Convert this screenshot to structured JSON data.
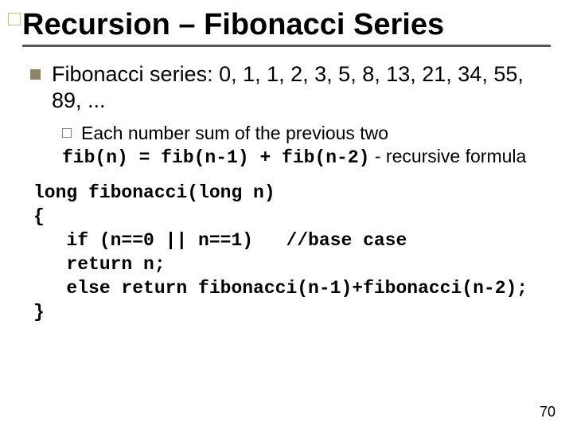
{
  "title": "Recursion – Fibonacci Series",
  "bullet1": "Fibonacci series: 0, 1, 1, 2, 3, 5, 8, 13, 21, 34, 55, 89, ...",
  "sub1_line1": "Each number sum of the previous two",
  "sub1_line2_pre": "fib(n) = fib(n-1) + fib(n-2)",
  "sub1_line2_post": " - recursive formula",
  "code": "long fibonacci(long n)\n{\n   if (n==0 || n==1)   //base case\n   return n;\n   else return fibonacci(n-1)+fibonacci(n-2);\n}",
  "page_number": "70"
}
